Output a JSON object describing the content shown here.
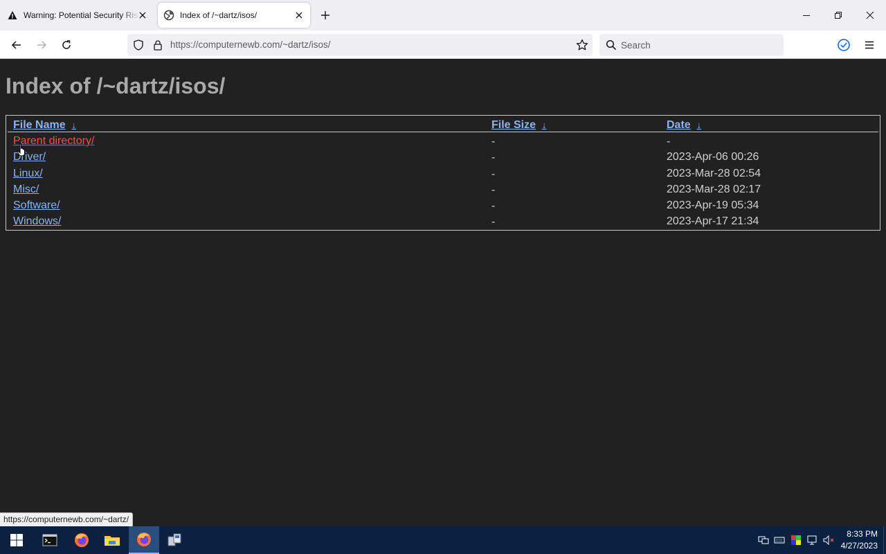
{
  "browser": {
    "tabs": [
      {
        "title": "Warning: Potential Security Risk Ahead"
      },
      {
        "title": "Index of /~dartz/isos/"
      }
    ],
    "url": {
      "host": "https://computernewb.com",
      "path": "/~dartz/isos/"
    },
    "search_placeholder": "Search",
    "status_url": "https://computernewb.com/~dartz/"
  },
  "page": {
    "heading": "Index of /~dartz/isos/",
    "columns": {
      "name": "File Name",
      "size": "File Size",
      "date": "Date",
      "sort_arrow": "↓"
    },
    "rows": [
      {
        "name": "Parent directory/",
        "size": "-",
        "date": "-"
      },
      {
        "name": "Driver/",
        "size": "-",
        "date": "2023-Apr-06 00:26"
      },
      {
        "name": "Linux/",
        "size": "-",
        "date": "2023-Mar-28 02:54"
      },
      {
        "name": "Misc/",
        "size": "-",
        "date": "2023-Mar-28 02:17"
      },
      {
        "name": "Software/",
        "size": "-",
        "date": "2023-Apr-19 05:34"
      },
      {
        "name": "Windows/",
        "size": "-",
        "date": "2023-Apr-17 21:34"
      }
    ]
  },
  "taskbar": {
    "time": "8:33 PM",
    "date": "4/27/2023",
    "apps": [
      "start-icon",
      "terminal-icon",
      "firefox-icon",
      "file-explorer-icon",
      "firefox-icon",
      "network-app-icon"
    ]
  },
  "colors": {
    "page_bg": "#212121",
    "link": "#8ab4f8",
    "link_hover": "#ff4d4d",
    "heading": "#a9a9a9",
    "taskbar_bg": "#0b2142"
  }
}
